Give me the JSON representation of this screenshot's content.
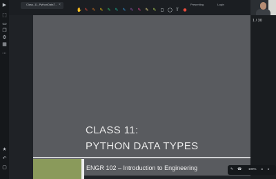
{
  "app": {
    "file_name": "Class_11_PythonDataT..."
  },
  "toolbar": {
    "right_link_1": "Presenting",
    "right_link_2": "Login",
    "tools": [
      {
        "name": "hand-icon",
        "glyph": "✋",
        "color": "#d0d3d7"
      },
      {
        "name": "pen-red-icon",
        "glyph": "✎",
        "color": "#e74c3c"
      },
      {
        "name": "pen-orange-icon",
        "glyph": "✎",
        "color": "#e67e22"
      },
      {
        "name": "pen-yellow-icon",
        "glyph": "✎",
        "color": "#f1c40f"
      },
      {
        "name": "pen-green-icon",
        "glyph": "✎",
        "color": "#2ecc71"
      },
      {
        "name": "pen-teal-icon",
        "glyph": "✎",
        "color": "#1abc9c"
      },
      {
        "name": "pen-blue-icon",
        "glyph": "✎",
        "color": "#3498db"
      },
      {
        "name": "pen-purple-icon",
        "glyph": "✎",
        "color": "#9b59b6"
      },
      {
        "name": "pen-pink-icon",
        "glyph": "✎",
        "color": "#e84393"
      },
      {
        "name": "highlighter-icon",
        "glyph": "✎",
        "color": "#f6e58d"
      },
      {
        "name": "highlighter-green-icon",
        "glyph": "✎",
        "color": "#badc58"
      },
      {
        "name": "eraser-icon",
        "glyph": "◻",
        "color": "#dfe6e9"
      },
      {
        "name": "shape-icon",
        "glyph": "◯",
        "color": "#dfe6e9"
      },
      {
        "name": "text-icon",
        "glyph": "T",
        "color": "#dfe6e9"
      },
      {
        "name": "laser-icon",
        "glyph": "●",
        "color": "#e74c3c"
      }
    ]
  },
  "sidebar": {
    "icons": [
      "play-icon",
      "select-icon",
      "page-icon",
      "copy-icon",
      "settings-icon",
      "grid-icon",
      "more-icon"
    ]
  },
  "viewer": {
    "page_indicator": "1 / 30"
  },
  "slide": {
    "title_line1": "CLASS 11:",
    "title_line2": "PYTHON DATA TYPES",
    "subtitle": "ENGR 102 – Introduction to Engineering",
    "accent_color": "#8a9a5b"
  },
  "bottom_controls": {
    "zoom": "100%"
  }
}
